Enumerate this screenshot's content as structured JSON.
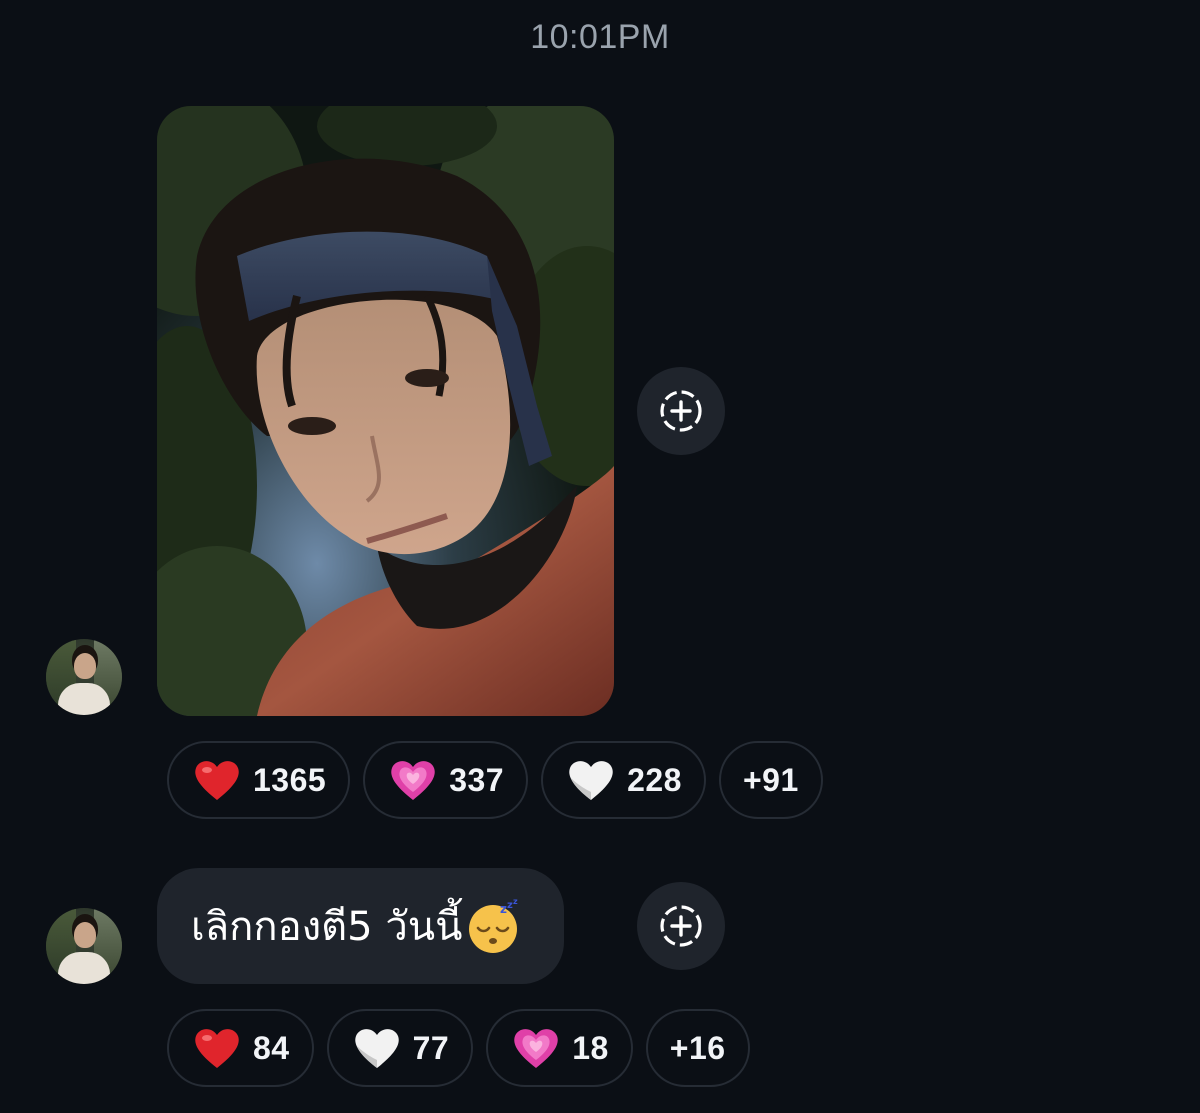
{
  "timestamp": "10:01PM",
  "messages": [
    {
      "type": "photo",
      "reactions": [
        {
          "emoji": "red-heart",
          "count": "1365"
        },
        {
          "emoji": "sparkling-pink-heart",
          "count": "337"
        },
        {
          "emoji": "white-heart",
          "count": "228"
        }
      ],
      "more": "+91"
    },
    {
      "type": "text",
      "text": "เลิกกองตี5 วันนี้",
      "emoji": "sleeping-face",
      "reactions": [
        {
          "emoji": "red-heart",
          "count": "84"
        },
        {
          "emoji": "white-heart",
          "count": "77"
        },
        {
          "emoji": "sparkling-pink-heart",
          "count": "18"
        }
      ],
      "more": "+16"
    }
  ],
  "icons": {
    "add_reaction": "add-reaction-icon"
  },
  "colors": {
    "background": "#0b0f15",
    "bubble": "#1f242c",
    "pill_border": "#262c35",
    "timestamp": "#9aa3ad"
  }
}
